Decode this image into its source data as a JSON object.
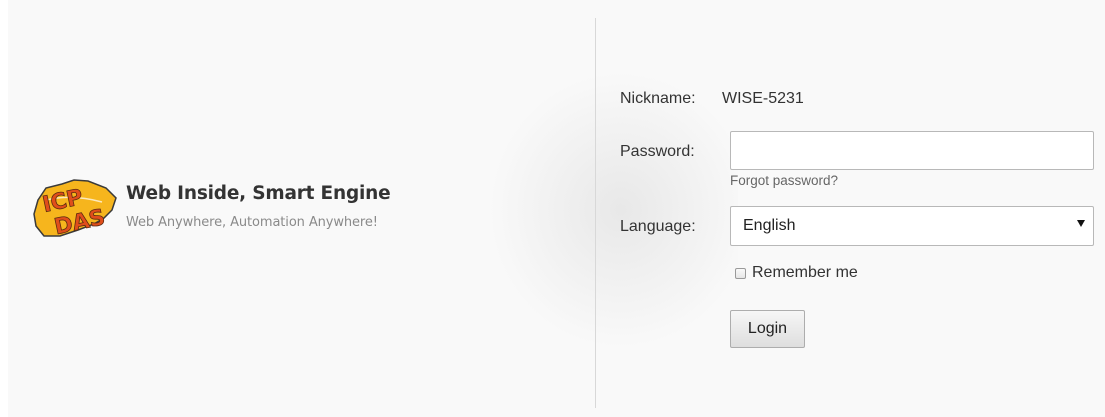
{
  "brand": {
    "logo_text_top": "ICP",
    "logo_text_bottom": "DAS",
    "title": "Web Inside, Smart Engine",
    "subtitle": "Web Anywhere, Automation Anywhere!",
    "logo_colors": {
      "fill": "#f6b51d",
      "letters": "#e04e1b",
      "outline": "#3a3a3a"
    }
  },
  "form": {
    "nickname_label": "Nickname:",
    "nickname_value": "WISE-5231",
    "password_label": "Password:",
    "password_value": "",
    "forgot_password": "Forgot password?",
    "language_label": "Language:",
    "language_selected": "English",
    "remember_label": "Remember me",
    "remember_checked": false,
    "login_label": "Login"
  }
}
